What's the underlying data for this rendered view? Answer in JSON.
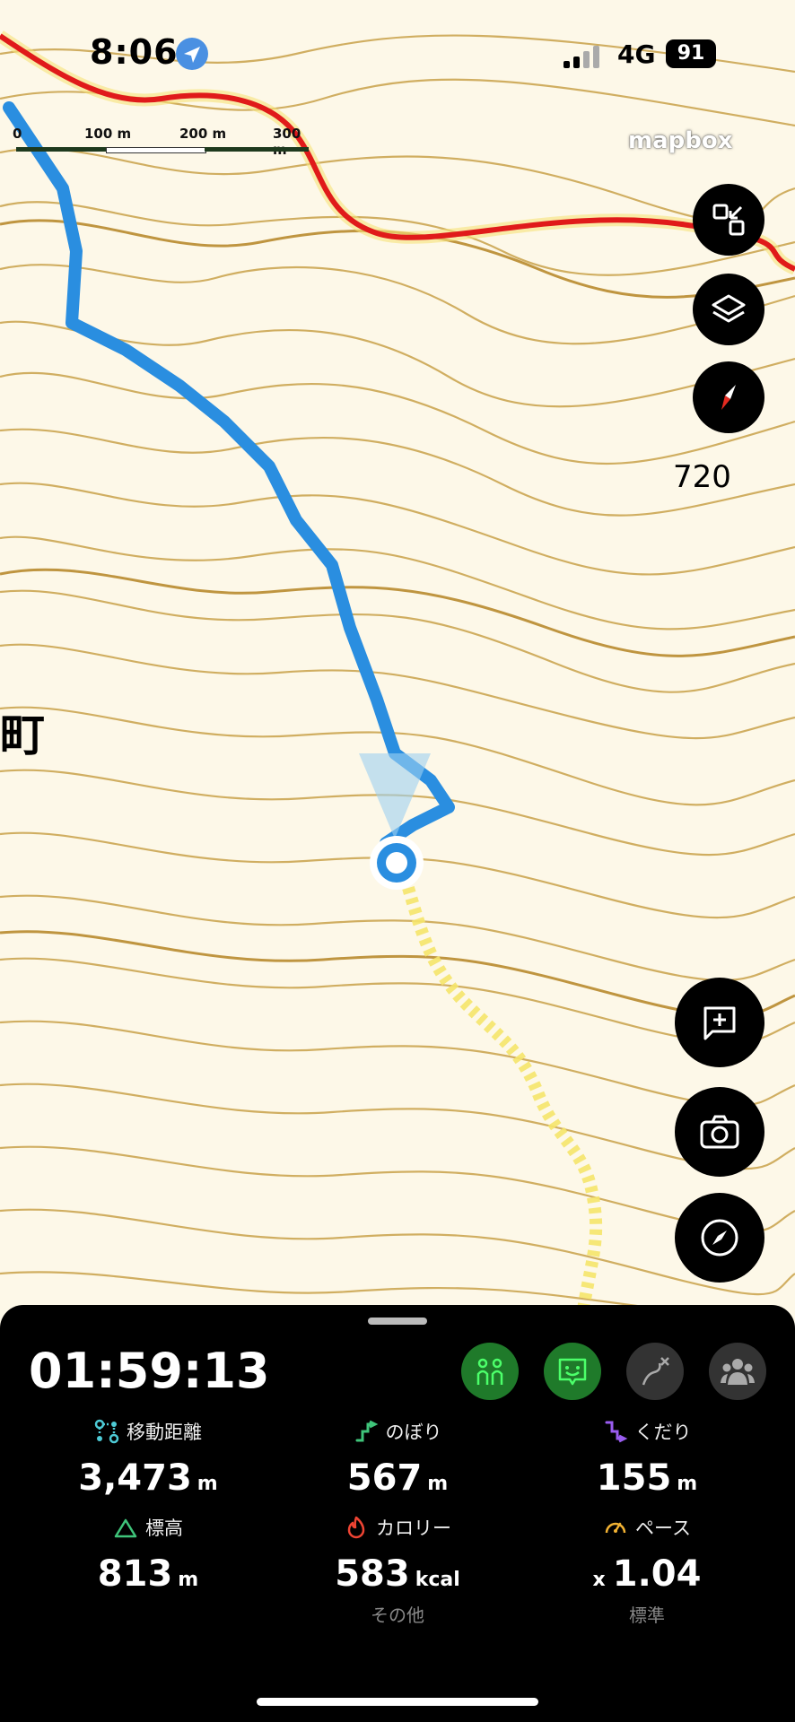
{
  "status_bar": {
    "time": "8:06",
    "network": "4G",
    "battery": "91"
  },
  "map": {
    "scale_labels": [
      "0",
      "100 m",
      "200 m",
      "300 m"
    ],
    "attribution": "mapbox",
    "elevation_label": "720",
    "place_label": "町"
  },
  "controls": {
    "right_top": [
      "collapse-icon",
      "layers-icon",
      "compass-needle-icon"
    ],
    "right_bottom": [
      "add-note-icon",
      "camera-icon",
      "compass-icon"
    ]
  },
  "panel": {
    "elapsed": "01:59:13",
    "stats": [
      {
        "label": "移動距離",
        "value": "3,473",
        "unit": "m",
        "icon": "distance-icon",
        "color": "#4ecbd6"
      },
      {
        "label": "のぼり",
        "value": "567",
        "unit": "m",
        "icon": "ascent-icon",
        "color": "#3fc47a"
      },
      {
        "label": "くだり",
        "value": "155",
        "unit": "m",
        "icon": "descent-icon",
        "color": "#9a5cf0"
      },
      {
        "label": "標高",
        "value": "813",
        "unit": "m",
        "icon": "mountain-icon",
        "color": "#3fc47a"
      },
      {
        "label": "カロリー",
        "value": "583",
        "unit": "kcal",
        "icon": "flame-icon",
        "color": "#ee4433"
      },
      {
        "label": "ペース",
        "prefix": "x",
        "value": "1.04",
        "unit": "",
        "icon": "speedometer-icon",
        "color": "#f2b233"
      }
    ],
    "sub_labels": {
      "calorie": "その他",
      "pace": "標準"
    }
  }
}
